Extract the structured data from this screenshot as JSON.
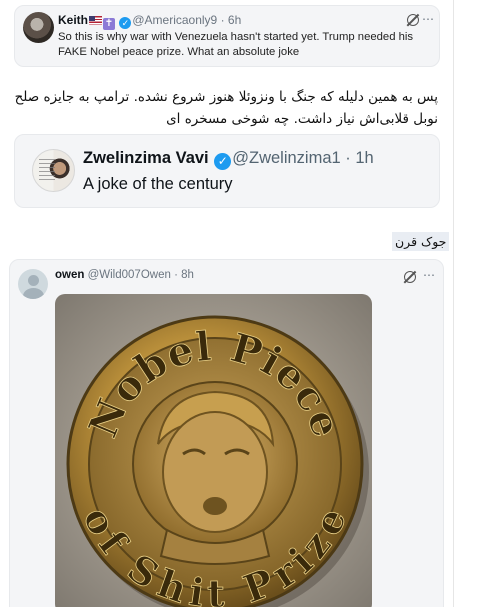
{
  "top_tweet": {
    "name": "Keith",
    "verified_mark": "✓",
    "cross_badge": "✝",
    "handle": "@Americaonly9",
    "time": "· 6h",
    "text": "So this is why war with Venezuela hasn't started yet. Trump needed his FAKE Nobel peace prize. What an absolute joke",
    "more_icon": "⋯"
  },
  "persian_comment": "پس به همین دلیله که جنگ با ونزوئلا هنوز شروع نشده. ترامپ به جایزه صلح نوبل قلابی‌اش نیاز داشت. چه شوخی مسخره ای",
  "quoted_tweet": {
    "name": "Zwelinzima Vavi",
    "verified_mark": "✓",
    "handle": "@Zwelinzima1",
    "time": "· 1h",
    "text": "A joke of the century"
  },
  "persian_reply": "جوک قرن",
  "bottom_tweet": {
    "name": "owen",
    "handle": "@Wild007Owen",
    "time": "· 8h",
    "more_icon": "⋯",
    "image": {
      "medal_text_top": "Nobel Piece",
      "medal_text_bottom": "of Shit Prize"
    }
  },
  "colors": {
    "verified_blue": "#1d9bf0",
    "card_bg": "#f4f5f7",
    "gold": "#b8923f",
    "handle_gray": "#536471"
  }
}
